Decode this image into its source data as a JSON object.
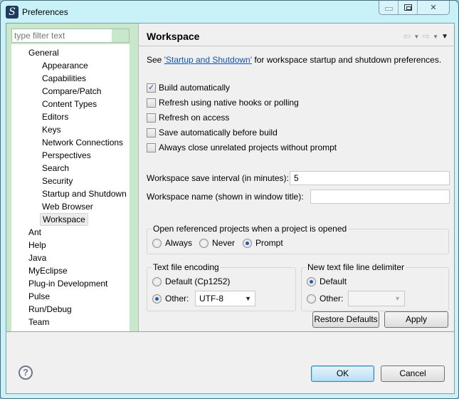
{
  "window": {
    "title": "Preferences",
    "app_icon_glyph": "S",
    "controls": {
      "minimize": "minimize-icon",
      "maximize": "maximize-icon",
      "close": "✕"
    }
  },
  "left_panel": {
    "filter_placeholder": "type filter text",
    "filter_value": "",
    "tree": [
      {
        "label": "General",
        "level": 0
      },
      {
        "label": "Appearance",
        "level": 1
      },
      {
        "label": "Capabilities",
        "level": 1
      },
      {
        "label": "Compare/Patch",
        "level": 1
      },
      {
        "label": "Content Types",
        "level": 1
      },
      {
        "label": "Editors",
        "level": 1
      },
      {
        "label": "Keys",
        "level": 1
      },
      {
        "label": "Network Connections",
        "level": 1
      },
      {
        "label": "Perspectives",
        "level": 1
      },
      {
        "label": "Search",
        "level": 1
      },
      {
        "label": "Security",
        "level": 1
      },
      {
        "label": "Startup and Shutdown",
        "level": 1
      },
      {
        "label": "Web Browser",
        "level": 1
      },
      {
        "label": "Workspace",
        "level": 1,
        "selected": true
      },
      {
        "label": "Ant",
        "level": 0
      },
      {
        "label": "Help",
        "level": 0
      },
      {
        "label": "Java",
        "level": 0
      },
      {
        "label": "MyEclipse",
        "level": 0
      },
      {
        "label": "Plug-in Development",
        "level": 0
      },
      {
        "label": "Pulse",
        "level": 0
      },
      {
        "label": "Run/Debug",
        "level": 0
      },
      {
        "label": "Team",
        "level": 0
      }
    ]
  },
  "page": {
    "title": "Workspace",
    "nav": {
      "back": "⇦",
      "forward": "⇨",
      "dropdown": "▼",
      "menu": "▼"
    },
    "description": {
      "prefix": "See ",
      "link": "'Startup and Shutdown'",
      "suffix": " for workspace startup and shutdown preferences."
    },
    "checkboxes": [
      {
        "label": "Build automatically",
        "checked": true
      },
      {
        "label": "Refresh using native hooks or polling",
        "checked": false
      },
      {
        "label": "Refresh on access",
        "checked": false
      },
      {
        "label": "Save automatically before build",
        "checked": false
      },
      {
        "label": "Always close unrelated projects without prompt",
        "checked": false
      }
    ],
    "save_interval": {
      "label": "Workspace save interval (in minutes):",
      "value": "5"
    },
    "workspace_name": {
      "label": "Workspace name (shown in window title):",
      "value": ""
    },
    "open_referenced": {
      "title": "Open referenced projects when a project is opened",
      "options": [
        "Always",
        "Never",
        "Prompt"
      ],
      "selected": "Prompt"
    },
    "text_encoding": {
      "title": "Text file encoding",
      "default_label": "Default (Cp1252)",
      "other_label": "Other:",
      "selected": "Other",
      "other_value": "UTF-8"
    },
    "line_delimiter": {
      "title": "New text file line delimiter",
      "default_label": "Default",
      "other_label": "Other:",
      "selected": "Default",
      "other_value": ""
    },
    "buttons": {
      "restore_defaults": "Restore Defaults",
      "apply": "Apply"
    }
  },
  "footer": {
    "help": "?",
    "ok": "OK",
    "cancel": "Cancel"
  },
  "colors": {
    "link": "#0a57b5",
    "titlebar": "#c8f2f8",
    "left_panel_bg": "#c8e8cc",
    "radio_selected": "#1f5ea8",
    "default_button": "#b7dff4"
  }
}
